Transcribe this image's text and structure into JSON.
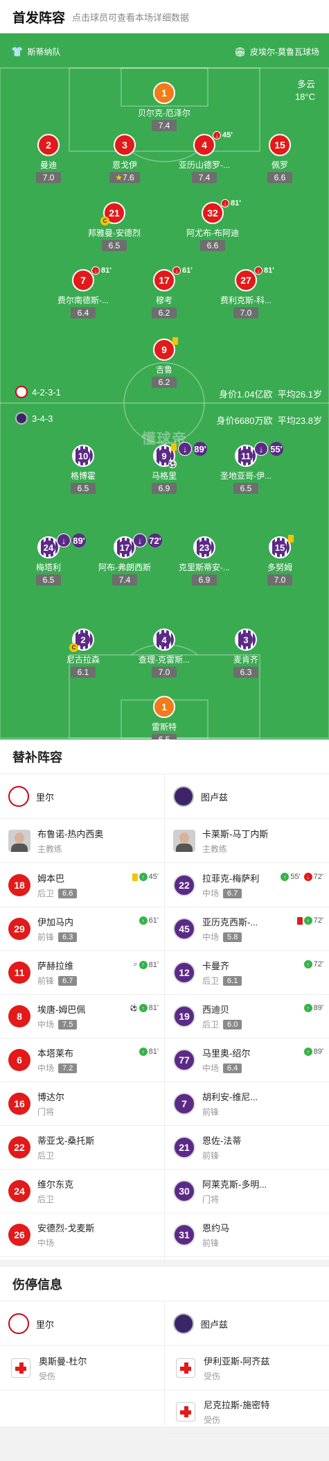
{
  "header": {
    "title": "首发阵容",
    "subtitle": "点击球员可查看本场详细数据"
  },
  "pitch": {
    "home_team": "斯蒂纳队",
    "away_team": "皮埃尔-莫鲁瓦球场",
    "weather": "多云",
    "temperature": "18°C",
    "watermark": "懂球帝",
    "home_formation": "4-2-3-1",
    "home_value": "身价1.04亿欧",
    "home_age": "平均26.1岁",
    "away_formation": "3-4-3",
    "away_value": "身价6680万欧",
    "away_age": "平均23.8岁",
    "home_players": [
      {
        "num": "1",
        "name": "贝尔克-厄泽尔",
        "rating": "7.4",
        "gk": true
      },
      {
        "num": "2",
        "name": "曼迪",
        "rating": "7.0"
      },
      {
        "num": "3",
        "name": "恩戈伊",
        "rating": "7.6",
        "star": true
      },
      {
        "num": "4",
        "name": "亚历山德罗-...",
        "rating": "7.4",
        "sub": "45'"
      },
      {
        "num": "15",
        "name": "佩罗",
        "rating": "6.6"
      },
      {
        "num": "21",
        "name": "邦雅曼-安德烈",
        "rating": "6.5",
        "captain": true
      },
      {
        "num": "32",
        "name": "阿尤布-布阿迪",
        "rating": "6.6",
        "sub": "81'"
      },
      {
        "num": "7",
        "name": "费尔南德斯-...",
        "rating": "6.4",
        "sub": "81'"
      },
      {
        "num": "17",
        "name": "穆考",
        "rating": "6.2",
        "sub": "61'"
      },
      {
        "num": "27",
        "name": "费利克斯-科...",
        "rating": "7.0",
        "sub": "81'"
      },
      {
        "num": "9",
        "name": "吉鲁",
        "rating": "6.2",
        "yellow": true
      }
    ],
    "away_players": [
      {
        "num": "10",
        "name": "格博霍",
        "rating": "6.5"
      },
      {
        "num": "9",
        "name": "马格里",
        "rating": "6.9",
        "sub": "89'",
        "yellow": true,
        "goal": true
      },
      {
        "num": "11",
        "name": "圣地亚哥-伊...",
        "rating": "6.5",
        "sub": "55'"
      },
      {
        "num": "24",
        "name": "梅塔利",
        "rating": "6.5",
        "sub": "89'"
      },
      {
        "num": "17",
        "name": "阿布-弗朗西斯",
        "rating": "7.4",
        "sub": "72'"
      },
      {
        "num": "23",
        "name": "克里斯蒂安-...",
        "rating": "6.9"
      },
      {
        "num": "15",
        "name": "多努姆",
        "rating": "7.0",
        "yellow": true
      },
      {
        "num": "2",
        "name": "尼古拉森",
        "rating": "6.1",
        "captain": true
      },
      {
        "num": "4",
        "name": "查理-克雷斯...",
        "rating": "7.0"
      },
      {
        "num": "3",
        "name": "麦肯齐",
        "rating": "6.3"
      },
      {
        "num": "1",
        "name": "雷斯特",
        "rating": "6.5",
        "gk": true
      }
    ]
  },
  "subs": {
    "title": "替补阵容",
    "home_team": "里尔",
    "away_team": "图卢兹",
    "home_coach": {
      "name": "布鲁诺-热内西奥",
      "role": "主教练"
    },
    "away_coach": {
      "name": "卡莱斯-马丁内斯",
      "role": "主教练"
    },
    "home": [
      {
        "num": "18",
        "name": "姆本巴",
        "pos": "后卫",
        "rating": "6.6",
        "ev": "45'"
      },
      {
        "num": "29",
        "name": "伊加马内",
        "pos": "前锋",
        "rating": "6.3",
        "ev": "61'"
      },
      {
        "num": "11",
        "name": "萨赫拉维",
        "pos": "前锋",
        "rating": "6.7",
        "ev": "81'"
      },
      {
        "num": "8",
        "name": "埃唐-姆巴佩",
        "pos": "中场",
        "rating": "7.5",
        "ev": "81'"
      },
      {
        "num": "6",
        "name": "本塔莱布",
        "pos": "中场",
        "rating": "7.2",
        "ev": "81'"
      },
      {
        "num": "16",
        "name": "博达尔",
        "pos": "门将",
        "rating": "",
        "ev": ""
      },
      {
        "num": "22",
        "name": "蒂亚戈-桑托斯",
        "pos": "后卫",
        "rating": "",
        "ev": ""
      },
      {
        "num": "24",
        "name": "维尔东克",
        "pos": "后卫",
        "rating": "",
        "ev": ""
      },
      {
        "num": "26",
        "name": "安德烈-戈麦斯",
        "pos": "中场",
        "rating": "",
        "ev": ""
      }
    ],
    "away": [
      {
        "num": "22",
        "name": "拉菲克-梅萨利",
        "pos": "中场",
        "rating": "6.7",
        "ev": "55'",
        "ev2": "72'"
      },
      {
        "num": "45",
        "name": "亚历克西斯-...",
        "pos": "中场",
        "rating": "5.8",
        "ev": "72'"
      },
      {
        "num": "12",
        "name": "卡曼齐",
        "pos": "后卫",
        "rating": "6.1",
        "ev": "72'"
      },
      {
        "num": "19",
        "name": "西迪贝",
        "pos": "后卫",
        "rating": "6.0",
        "ev": "89'"
      },
      {
        "num": "77",
        "name": "马里奥-绍尔",
        "pos": "中场",
        "rating": "6.4",
        "ev": "89'"
      },
      {
        "num": "7",
        "name": "胡利安-维尼...",
        "pos": "前锋",
        "rating": "",
        "ev": ""
      },
      {
        "num": "21",
        "name": "恩佐-法蒂",
        "pos": "前锋",
        "rating": "",
        "ev": ""
      },
      {
        "num": "30",
        "name": "阿莱克斯-多明...",
        "pos": "门将",
        "rating": "",
        "ev": ""
      },
      {
        "num": "31",
        "name": "恩约马",
        "pos": "前锋",
        "rating": "",
        "ev": ""
      }
    ]
  },
  "injuries": {
    "title": "伤停信息",
    "home_team": "里尔",
    "away_team": "图卢兹",
    "home": [
      {
        "name": "奥斯曼-杜尔",
        "status": "受伤"
      }
    ],
    "away": [
      {
        "name": "伊利亚斯-阿齐兹",
        "status": "受伤"
      },
      {
        "name": "尼克拉斯-施密特",
        "status": "受伤"
      }
    ]
  }
}
